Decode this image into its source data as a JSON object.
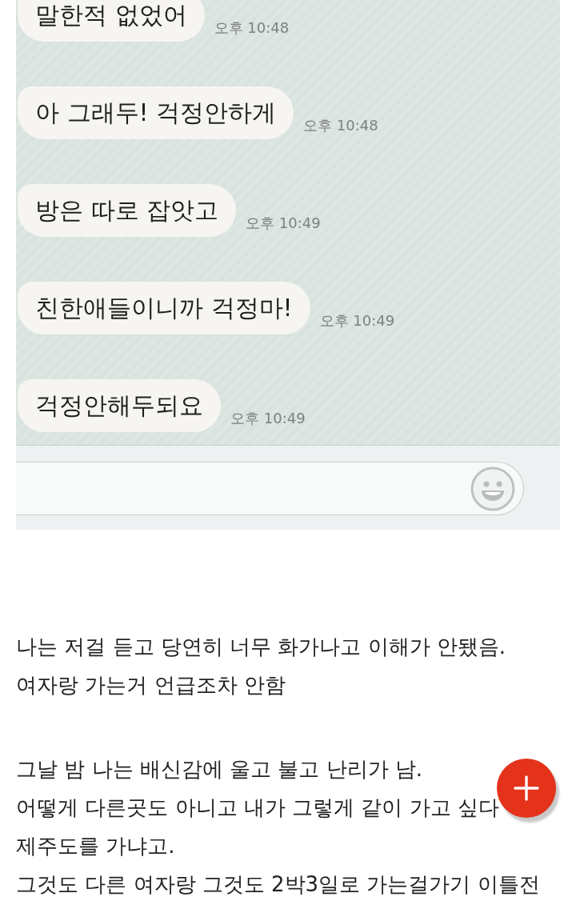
{
  "chat": {
    "messages": [
      {
        "text": "말한적 없었어",
        "time": "오후 10:48"
      },
      {
        "text": "아 그래두! 걱정안하게",
        "time": "오후 10:48"
      },
      {
        "text": "방은 따로 잡앗고",
        "time": "오후 10:49"
      },
      {
        "text": "친한애들이니까 걱정마!",
        "time": "오후 10:49"
      },
      {
        "text": "걱정안해두되요",
        "time": "오후 10:49"
      }
    ]
  },
  "post": {
    "paragraphs": [
      {
        "lines": [
          "나는 저걸 듣고 당연히 너무 화가나고 이해가 안됐음.",
          "여자랑 가는거 언급조차 안함"
        ]
      },
      {
        "lines": [
          "그날 밤 나는 배신감에 울고 불고 난리가 남.",
          "어떻게 다른곳도 아니고 내가 그렇게 같이 가고 싶다",
          "제주도를 가냐고.",
          "그것도 다른 여자랑 그것도 2박3일로 가는걸가기 이틀전"
        ]
      }
    ]
  }
}
